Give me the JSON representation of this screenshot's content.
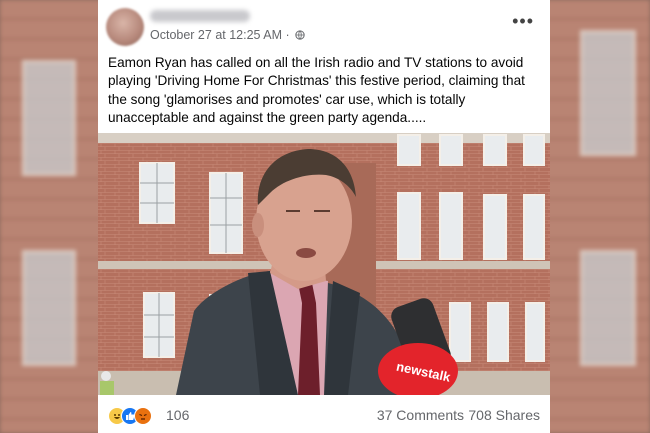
{
  "post": {
    "author_name": "",
    "timestamp": "October 27 at 12:25 AM · ",
    "privacy_icon": "globe-icon",
    "more_icon": "more-options-icon",
    "text": "Eamon Ryan has called on all the Irish radio and TV stations to avoid playing 'Driving Home For Christmas' this festive period, claiming that the song 'glamorises and promotes' car use, which is totally unacceptable and against the green party agenda.....",
    "photo": {
      "mic_brand": "newstalk",
      "colors": {
        "brick": "#b5705d",
        "jacket": "#3c4248",
        "shirt": "#d9a3b0",
        "tie": "#6e1f2c",
        "mic": "#e3242b"
      }
    },
    "reactions": {
      "icons": [
        "laugh-react-icon",
        "like-react-icon",
        "angry-react-icon"
      ],
      "count": "106"
    },
    "comments": "37 Comments",
    "shares": "708 Shares"
  }
}
